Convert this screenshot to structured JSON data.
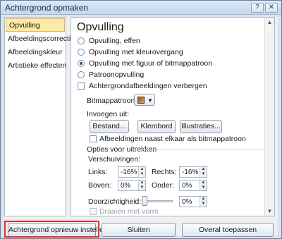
{
  "window": {
    "title": "Achtergrond opmaken",
    "help_icon": "?",
    "close_icon": "✕"
  },
  "nav": {
    "items": [
      {
        "label": "Opvulling",
        "active": true
      },
      {
        "label": "Afbeeldingscorrecties",
        "active": false
      },
      {
        "label": "Afbeeldingskleur",
        "active": false
      },
      {
        "label": "Artistieke effecten",
        "active": false
      }
    ]
  },
  "panel": {
    "title": "Opvulling",
    "options": {
      "solid": "Opvulling, effen",
      "gradient": "Opvulling met kleurovergang",
      "picture": "Opvulling met figuur of bitmappatroon",
      "pattern": "Patroonopvulling",
      "hide_bg": "Achtergrondafbeeldingen verbergen"
    },
    "selected_option": "picture",
    "bitmap_label": "Bitmappatroon:",
    "insert_from": "Invoegen uit:",
    "buttons": {
      "file": "Bestand...",
      "clipboard": "Klembord",
      "clipart": "Illustraties..."
    },
    "tile_label": "Afbeeldingen naast elkaar als bitmappatroon",
    "stretch_label": "Opties voor uitrekken",
    "offsets_label": "Verschuivingen:",
    "offsets": {
      "left": {
        "label": "Links:",
        "value": "-16%"
      },
      "right": {
        "label": "Rechts:",
        "value": "-16%"
      },
      "top": {
        "label": "Boven:",
        "value": "0%"
      },
      "bottom": {
        "label": "Onder:",
        "value": "0%"
      }
    },
    "transparency_label": "Doorzichtigheid:",
    "transparency_value": "0%",
    "transparency_level": 0,
    "rotate_label": "Draaien met vorm"
  },
  "footer": {
    "reset": "Achtergrond opnieuw instellen",
    "close": "Sluiten",
    "apply_all": "Overal toepassen"
  },
  "colors": {
    "accent_highlight": "#e03030",
    "nav_active": "#fde9a8"
  }
}
